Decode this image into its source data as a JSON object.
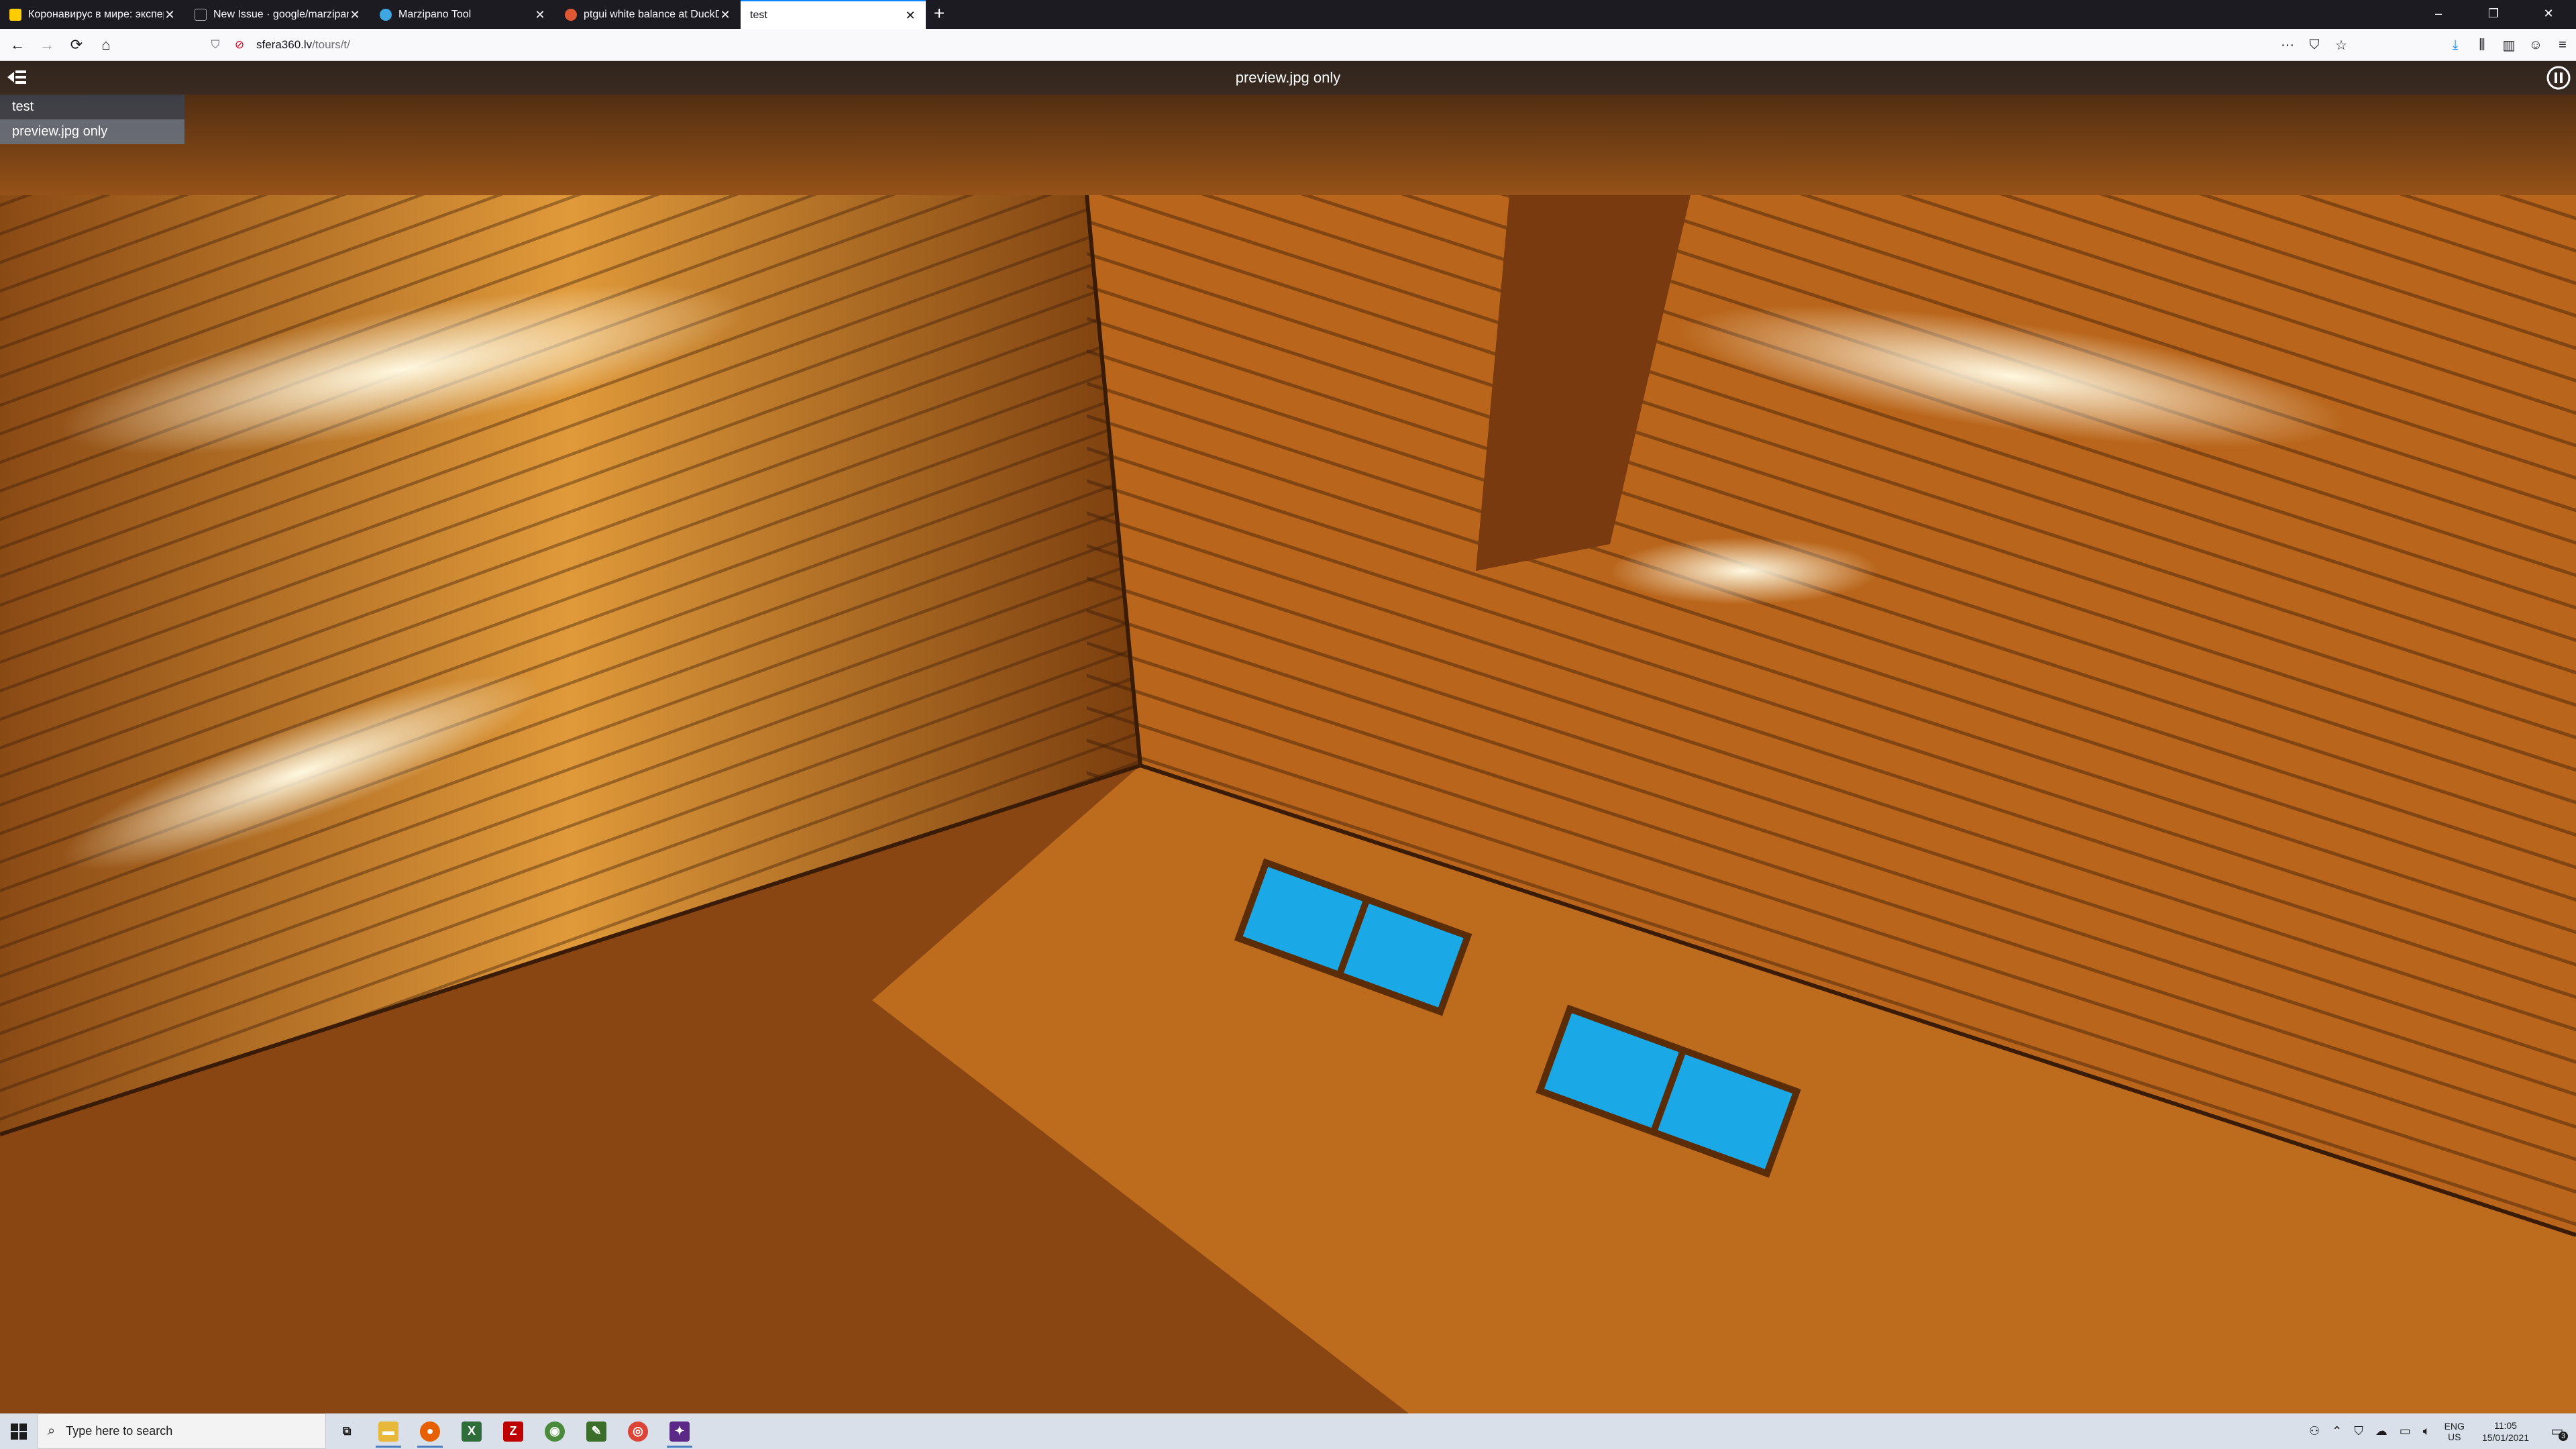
{
  "browser": {
    "tabs": [
      {
        "title": "Коронавирус в мире: экспер",
        "favicon_color": "#ffcc00",
        "active": false
      },
      {
        "title": "New Issue · google/marzipano",
        "favicon_color": "#1c1b22",
        "active": false
      },
      {
        "title": "Marzipano Tool",
        "favicon_color": "#3ea6e0",
        "active": false
      },
      {
        "title": "ptgui white balance at DuckDu",
        "favicon_color": "#de5833",
        "active": false
      },
      {
        "title": "test",
        "favicon_color": "#ffffff",
        "active": true
      }
    ],
    "new_tab_icon": "plus-icon",
    "window_controls": {
      "minimize": "–",
      "restore": "❐",
      "close": "✕"
    },
    "url": {
      "host": "sfera360.lv",
      "path": "/tours/t/"
    },
    "nav": {
      "back": "←",
      "forward": "→",
      "reload": "⟳",
      "home": "⌂"
    },
    "toolbar_icons": [
      "more-icon",
      "pocket-icon",
      "bookmark-star-icon",
      "downloads-icon",
      "library-icon",
      "sidebar-icon",
      "account-icon",
      "menu-icon"
    ]
  },
  "viewer": {
    "scene_title": "preview.jpg only",
    "scenes": [
      {
        "name": "test",
        "current": false
      },
      {
        "name": "preview.jpg only",
        "current": true
      }
    ]
  },
  "taskbar": {
    "search_placeholder": "Type here to search",
    "apps": [
      {
        "name": "task-view",
        "color": "#3b3b3b",
        "glyph": "▭",
        "running": false
      },
      {
        "name": "file-explorer",
        "color": "#e8b83a",
        "glyph": "▬",
        "running": true
      },
      {
        "name": "firefox",
        "color": "#e66000",
        "glyph": "●",
        "running": true
      },
      {
        "name": "excel-like",
        "color": "#2f6d3a",
        "glyph": "X",
        "running": false
      },
      {
        "name": "filezilla",
        "color": "#bf0000",
        "glyph": "Z",
        "running": false
      },
      {
        "name": "green-app",
        "color": "#4a8b3b",
        "glyph": "◉",
        "running": false
      },
      {
        "name": "graph-app",
        "color": "#3a6e2a",
        "glyph": "✎",
        "running": false
      },
      {
        "name": "chrome",
        "color": "#db4437",
        "glyph": "◎",
        "running": false
      },
      {
        "name": "ptgui",
        "color": "#5b2a86",
        "glyph": "✦",
        "running": true
      }
    ],
    "tray": {
      "lang_line1": "ENG",
      "lang_line2": "US",
      "time": "11:05",
      "date": "15/01/2021",
      "notification_count": "3"
    }
  }
}
